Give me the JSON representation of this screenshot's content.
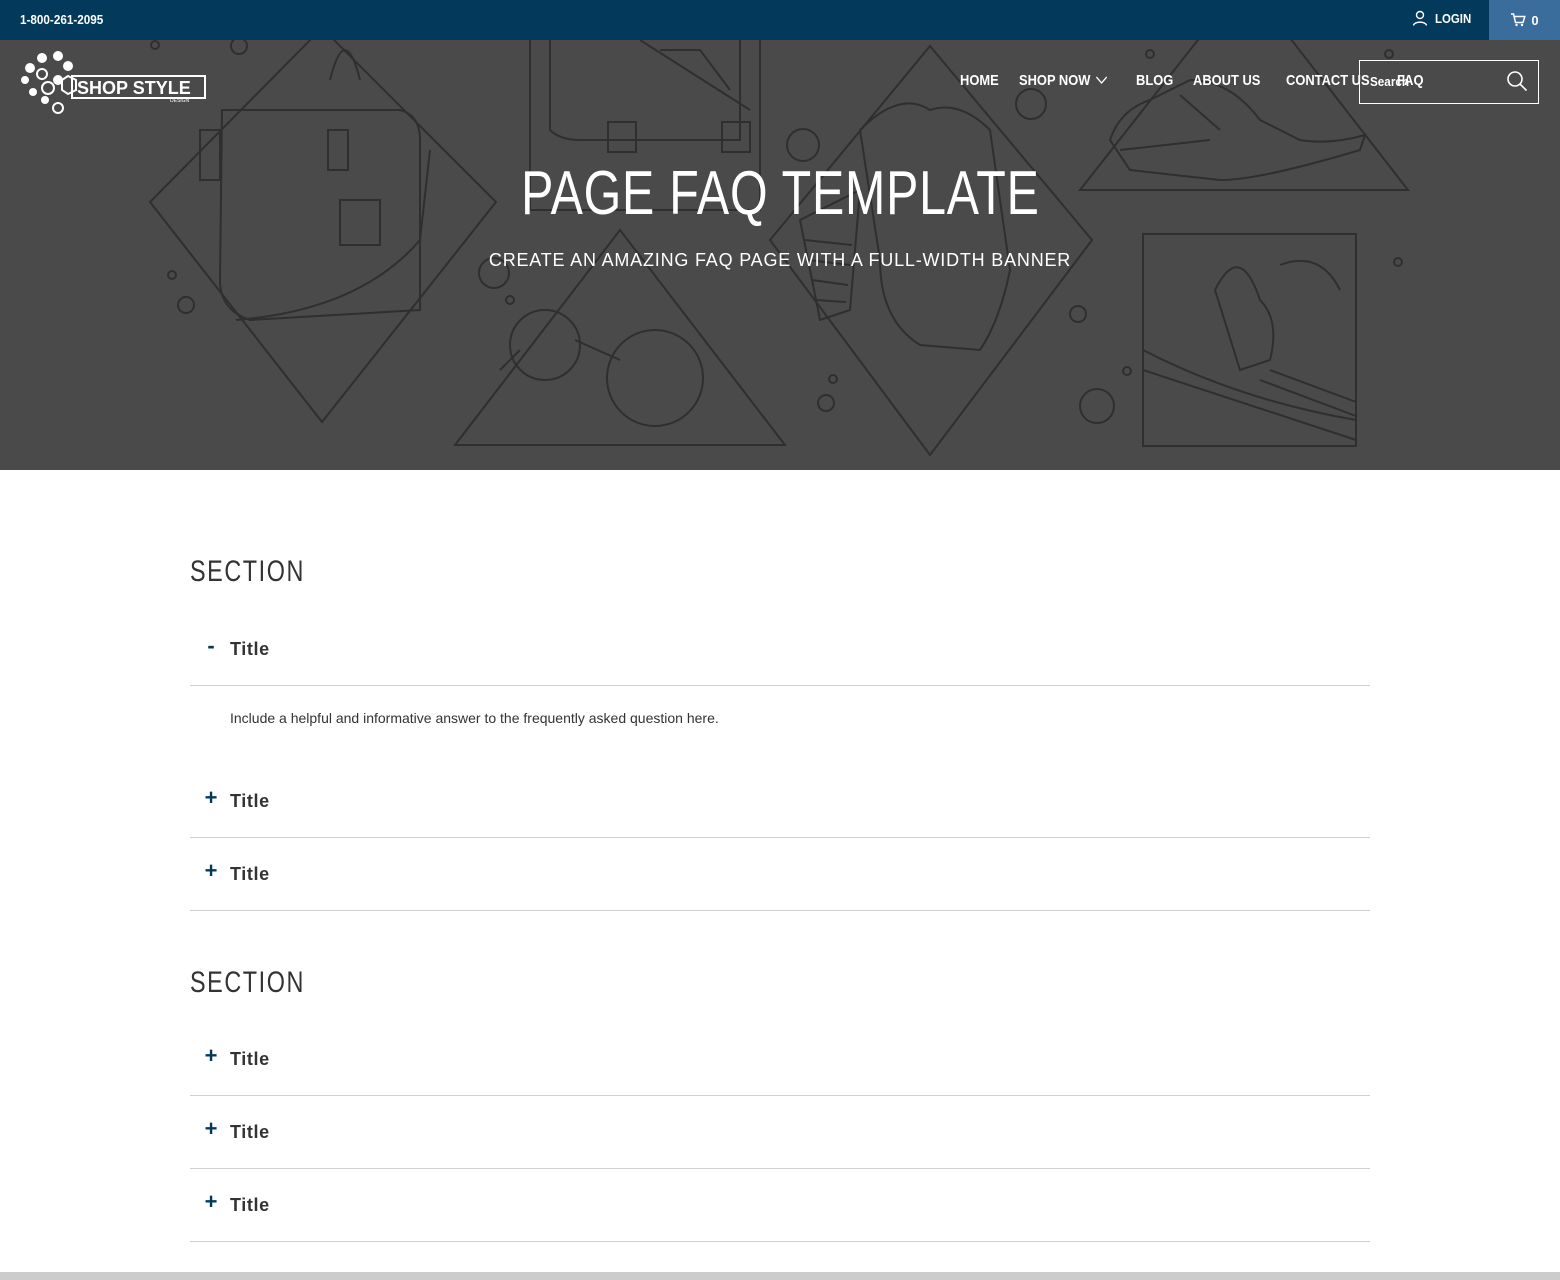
{
  "topbar": {
    "phone": "1-800-261-2095",
    "login_label": "LOGIN",
    "cart_count": "0"
  },
  "header": {
    "logo_text": "SHOP STYLE",
    "logo_subtext": "DESIGN",
    "nav": [
      {
        "label": "HOME"
      },
      {
        "label": "SHOP NOW"
      },
      {
        "label": "BLOG"
      },
      {
        "label": "ABOUT US"
      },
      {
        "label": "CONTACT US"
      },
      {
        "label": "FAQ"
      }
    ],
    "search_placeholder": "Search"
  },
  "hero": {
    "title": "PAGE FAQ TEMPLATE",
    "subtitle": "CREATE AN AMAZING FAQ PAGE WITH A FULL-WIDTH BANNER"
  },
  "faq": {
    "sections": [
      {
        "heading": "SECTION",
        "items": [
          {
            "title": "Title",
            "sign": "-",
            "answer": "Include a helpful and informative answer to the frequently asked question here."
          },
          {
            "title": "Title",
            "sign": "+"
          },
          {
            "title": "Title",
            "sign": "+"
          }
        ]
      },
      {
        "heading": "SECTION",
        "items": [
          {
            "title": "Title",
            "sign": "+"
          },
          {
            "title": "Title",
            "sign": "+"
          },
          {
            "title": "Title",
            "sign": "+"
          }
        ]
      }
    ]
  },
  "colors": {
    "topbar": "#033a5c",
    "cart": "#3b6d9c",
    "hero_bg": "#4a4a4a",
    "accent": "#033a5c"
  }
}
